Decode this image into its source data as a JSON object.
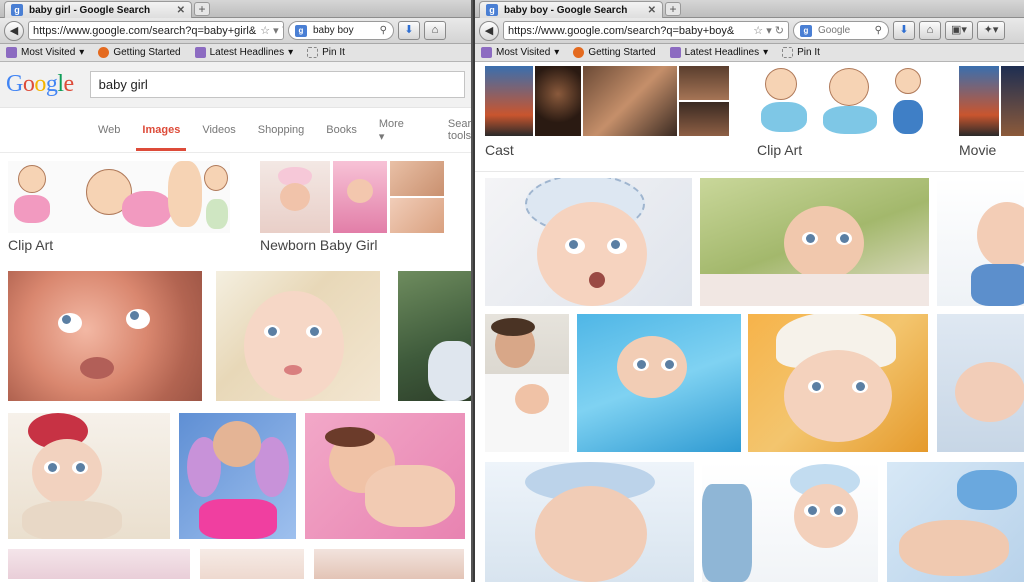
{
  "left": {
    "tab_title": "baby girl - Google Search",
    "url": "https://www.google.com/search?q=baby+girl&",
    "search_box": "baby boy",
    "bookmarks": [
      "Most Visited",
      "Getting Started",
      "Latest Headlines",
      "Pin It"
    ],
    "google_logo": "Google",
    "query": "baby girl",
    "nav": [
      "Web",
      "Images",
      "Videos",
      "Shopping",
      "Books",
      "More",
      "Search tools"
    ],
    "active_nav": "Images",
    "related": [
      {
        "label": "Clip Art"
      },
      {
        "label": "Newborn Baby Girl"
      }
    ]
  },
  "right": {
    "tab_title": "baby boy - Google Search",
    "url": "https://www.google.com/search?q=baby+boy&",
    "search_box": "Google",
    "bookmarks": [
      "Most Visited",
      "Getting Started",
      "Latest Headlines",
      "Pin It"
    ],
    "categories": [
      {
        "label": "Cast"
      },
      {
        "label": "Clip Art"
      },
      {
        "label": "Movie"
      }
    ]
  },
  "colors": {
    "google_blue": "#4285f4",
    "google_red": "#dd4b39",
    "google_yellow": "#f4b400",
    "google_green": "#0f9d58",
    "skin": "#f2c6ab",
    "eye": "#5b7fa3"
  },
  "icons": [
    "google-favicon",
    "back-arrow-icon",
    "star-icon",
    "search-magnifier-icon",
    "download-arrow-icon",
    "home-icon",
    "more-tools-icon",
    "dropdown-arrow-icon"
  ]
}
